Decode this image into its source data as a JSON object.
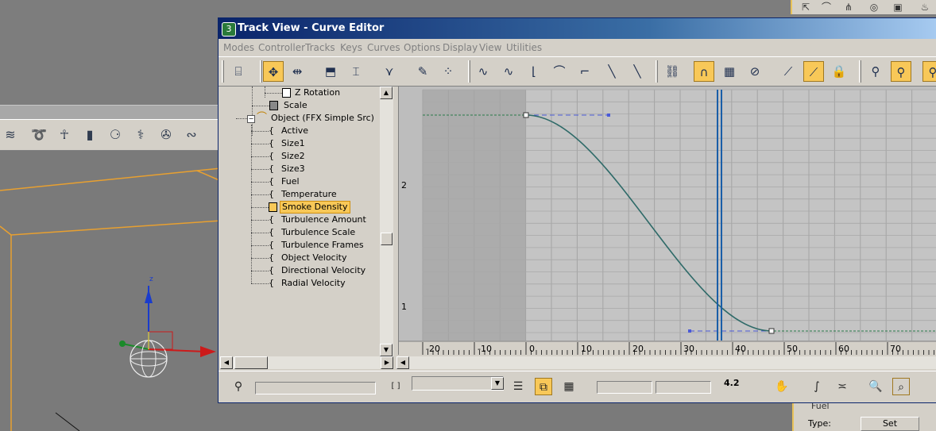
{
  "window": {
    "title": "Track View - Curve Editor"
  },
  "menus": [
    {
      "label": "Modes"
    },
    {
      "label": "Controller"
    },
    {
      "label": "Tracks"
    },
    {
      "label": "Keys"
    },
    {
      "label": "Curves"
    },
    {
      "label": "Options"
    },
    {
      "label": "Display"
    },
    {
      "label": "View"
    },
    {
      "label": "Utilities"
    }
  ],
  "hierarchy": {
    "items": [
      {
        "label": "Z Rotation"
      },
      {
        "label": "Scale"
      },
      {
        "label": "Object (FFX Simple Src)"
      },
      {
        "label": "Active"
      },
      {
        "label": "Size1"
      },
      {
        "label": "Size2"
      },
      {
        "label": "Size3"
      },
      {
        "label": "Fuel"
      },
      {
        "label": "Temperature"
      },
      {
        "label": "Smoke Density"
      },
      {
        "label": "Turbulence Amount"
      },
      {
        "label": "Turbulence Scale"
      },
      {
        "label": "Turbulence Frames"
      },
      {
        "label": "Object Velocity"
      },
      {
        "label": "Directional Velocity"
      },
      {
        "label": "Radial Velocity"
      }
    ],
    "selected": "Smoke Density"
  },
  "curve_editor": {
    "y_labels": [
      "2",
      "1"
    ],
    "x_labels": [
      "-20",
      "-10",
      "0",
      "10",
      "20",
      "30",
      "40",
      "50",
      "60",
      "70"
    ],
    "active_range_color": "#c4c4c4",
    "inactive_range_color": "#acacac",
    "curve_color": "#2e6a68",
    "time_slider_color": "#1a5ea8"
  },
  "bottom_bar": {
    "value_display": "4.2"
  },
  "background_panel": {
    "fuel_label": "Fuel",
    "type_label": "Type:",
    "set_button": "Set"
  },
  "gizmo": {
    "z_label": "z"
  },
  "colors": {
    "selection_highlight": "#f8c858",
    "title_gradient_start": "#0a246a",
    "title_gradient_end": "#a6caf0",
    "bounding_box": "#e8a030"
  }
}
